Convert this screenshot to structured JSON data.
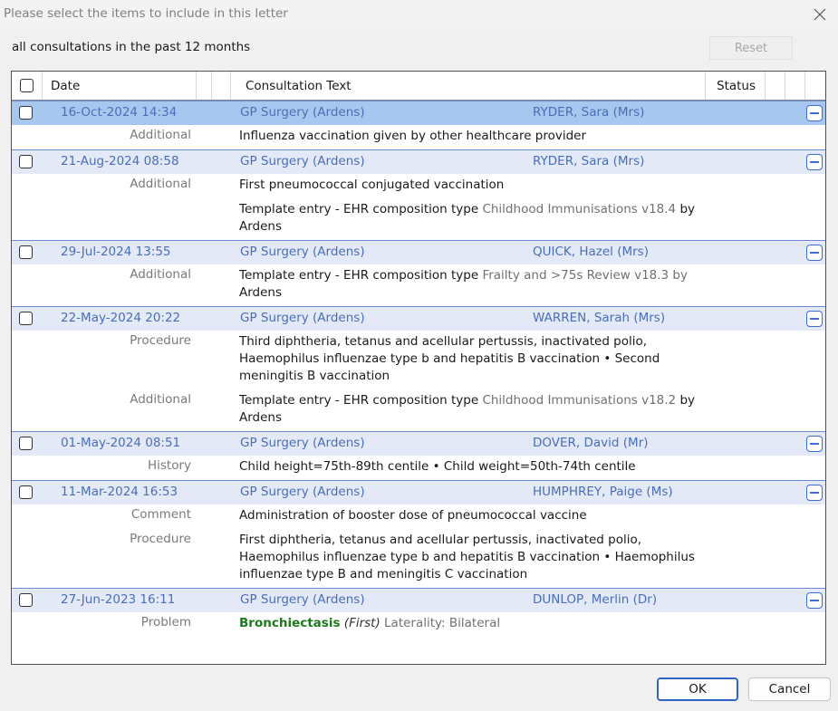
{
  "window": {
    "title": "Please select the items to include in this letter"
  },
  "filter_label": "all consultations in the past 12 months",
  "reset_label": "Reset",
  "columns": {
    "date": "Date",
    "text": "Consultation Text",
    "status": "Status"
  },
  "consultations": [
    {
      "date": "16-Oct-2024 14:34",
      "location": "GP Surgery (Ardens)",
      "clinician": "RYDER, Sara (Mrs)",
      "selected": true,
      "entries": [
        {
          "category": "Additional",
          "text": "Influenza vaccination given by other healthcare provider"
        }
      ]
    },
    {
      "date": "21-Aug-2024 08:58",
      "location": "GP Surgery (Ardens)",
      "clinician": "RYDER, Sara (Mrs)",
      "entries": [
        {
          "category": "Additional",
          "text": "First pneumococcal conjugated vaccination"
        },
        {
          "category": "",
          "text_prefix": "Template entry - EHR composition type",
          "text_muted": "Childhood Immunisations v18.4",
          "text_suffix": "by Ardens"
        }
      ]
    },
    {
      "date": "29-Jul-2024 13:55",
      "location": "GP Surgery (Ardens)",
      "clinician": "QUICK, Hazel (Mrs)",
      "entries": [
        {
          "category": "Additional",
          "text_prefix": "Template entry - EHR composition type",
          "text_muted": "Frailty and >75s Review v18.3 by",
          "text_suffix": "Ardens"
        }
      ]
    },
    {
      "date": "22-May-2024 20:22",
      "location": "GP Surgery (Ardens)",
      "clinician": "WARREN, Sarah (Mrs)",
      "entries": [
        {
          "category": "Procedure",
          "text": "Third diphtheria, tetanus and acellular pertussis, inactivated polio, Haemophilus influenzae type b and hepatitis B vaccination • Second meningitis B vaccination"
        },
        {
          "category": "Additional",
          "text_prefix": "Template entry - EHR composition type",
          "text_muted": "Childhood Immunisations v18.2",
          "text_suffix": "by Ardens"
        }
      ]
    },
    {
      "date": "01-May-2024 08:51",
      "location": "GP Surgery (Ardens)",
      "clinician": "DOVER, David (Mr)",
      "entries": [
        {
          "category": "History",
          "text": "Child height=75th-89th centile • Child weight=50th-74th centile"
        }
      ]
    },
    {
      "date": "11-Mar-2024 16:53",
      "location": "GP Surgery (Ardens)",
      "clinician": "HUMPHREY, Paige (Ms)",
      "entries": [
        {
          "category": "Comment",
          "text": "Administration of booster dose of pneumococcal vaccine"
        },
        {
          "category": "Procedure",
          "text": "First diphtheria, tetanus and acellular pertussis, inactivated polio, Haemophilus influenzae type b and hepatitis B vaccination • Haemophilus influenzae type B and meningitis C vaccination"
        }
      ]
    },
    {
      "date": "27-Jun-2023 16:11",
      "location": "GP Surgery (Ardens)",
      "clinician": "DUNLOP, Merlin (Dr)",
      "entries": [
        {
          "category": "Problem",
          "problem_name": "Bronchiectasis",
          "problem_flag": "(First)",
          "problem_detail": "Laterality: Bilateral"
        }
      ]
    }
  ],
  "buttons": {
    "ok": "OK",
    "cancel": "Cancel"
  },
  "colors": {
    "header_row": "#e3e9f6",
    "selected_row": "#a8c7ee",
    "link_text": "#4a6fb8",
    "problem_green": "#1c7a1c"
  }
}
